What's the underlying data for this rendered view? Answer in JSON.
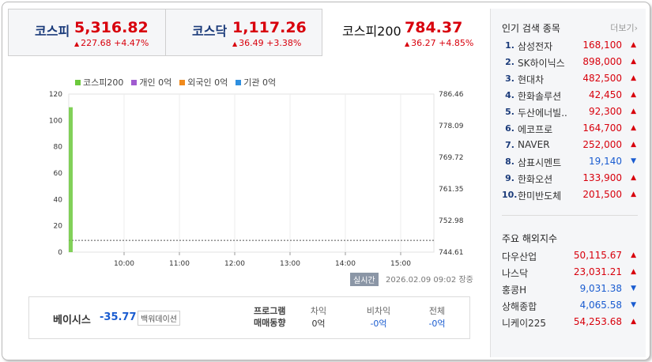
{
  "indices": [
    {
      "name": "코스피",
      "value": "5,316.82",
      "change": "227.68 +4.47%",
      "direction": "up"
    },
    {
      "name": "코스닥",
      "value": "1,117.26",
      "change": "36.49 +3.38%",
      "direction": "up"
    },
    {
      "name": "코스피200",
      "value": "784.37",
      "change": "36.27 +4.85%",
      "direction": "up"
    }
  ],
  "legend": [
    {
      "label": "코스피200",
      "color": "#6cc93c"
    },
    {
      "label": "개인 0억",
      "color": "#a05bd0"
    },
    {
      "label": "외국인 0억",
      "color": "#f08a1c"
    },
    {
      "label": "기관 0억",
      "color": "#2e8fe0"
    }
  ],
  "chart_data": {
    "type": "bar",
    "left_axis_ticks": [
      "120",
      "100",
      "80",
      "60",
      "40",
      "20",
      "0"
    ],
    "right_axis_ticks": [
      "786.46",
      "778.09",
      "769.72",
      "761.35",
      "752.98",
      "744.61"
    ],
    "x_ticks": [
      "10:00",
      "11:00",
      "12:00",
      "13:00",
      "14:00",
      "15:00"
    ],
    "left_ylim": [
      0,
      120
    ],
    "right_ylim": [
      744.61,
      786.46
    ],
    "series": [
      {
        "name": "코스피200",
        "values": [
          110
        ]
      }
    ],
    "baseline_right_value": 747.71
  },
  "status_badge": "실시간",
  "timestamp": "2026.02.09 09:02",
  "market_state": "장중",
  "basis": {
    "label": "베이시스",
    "value": "-35.77",
    "badge": "백워데이션"
  },
  "program": {
    "label_line1": "프로그램",
    "label_line2": "매매동향",
    "columns": [
      {
        "head": "차익",
        "value": "0억",
        "color": "normal"
      },
      {
        "head": "비차익",
        "value": "-0억",
        "color": "blue"
      },
      {
        "head": "전체",
        "value": "-0억",
        "color": "blue"
      }
    ]
  },
  "popular": {
    "title": "인기 검색 종목",
    "more": "더보기",
    "items": [
      {
        "rank": "1.",
        "name": "삼성전자",
        "price": "168,100",
        "dir": "up"
      },
      {
        "rank": "2.",
        "name": "SK하이닉스",
        "price": "898,000",
        "dir": "up"
      },
      {
        "rank": "3.",
        "name": "현대차",
        "price": "482,500",
        "dir": "up"
      },
      {
        "rank": "4.",
        "name": "한화솔루션",
        "price": "42,450",
        "dir": "up"
      },
      {
        "rank": "5.",
        "name": "두산에너빌..",
        "price": "92,300",
        "dir": "up"
      },
      {
        "rank": "6.",
        "name": "에코프로",
        "price": "164,700",
        "dir": "up"
      },
      {
        "rank": "7.",
        "name": "NAVER",
        "price": "252,000",
        "dir": "up"
      },
      {
        "rank": "8.",
        "name": "삼표시멘트",
        "price": "19,140",
        "dir": "down"
      },
      {
        "rank": "9.",
        "name": "한화오션",
        "price": "133,900",
        "dir": "up"
      },
      {
        "rank": "10.",
        "name": "한미반도체",
        "price": "201,500",
        "dir": "up"
      }
    ]
  },
  "overseas": {
    "title": "주요 해외지수",
    "items": [
      {
        "name": "다우산업",
        "value": "50,115.67",
        "dir": "up"
      },
      {
        "name": "나스닥",
        "value": "23,031.21",
        "dir": "up"
      },
      {
        "name": "홍콩H",
        "value": "9,031.38",
        "dir": "down"
      },
      {
        "name": "상해종합",
        "value": "4,065.58",
        "dir": "down"
      },
      {
        "name": "니케이225",
        "value": "54,253.68",
        "dir": "up"
      }
    ]
  },
  "arrows": {
    "up": "▲",
    "down": "▼"
  }
}
